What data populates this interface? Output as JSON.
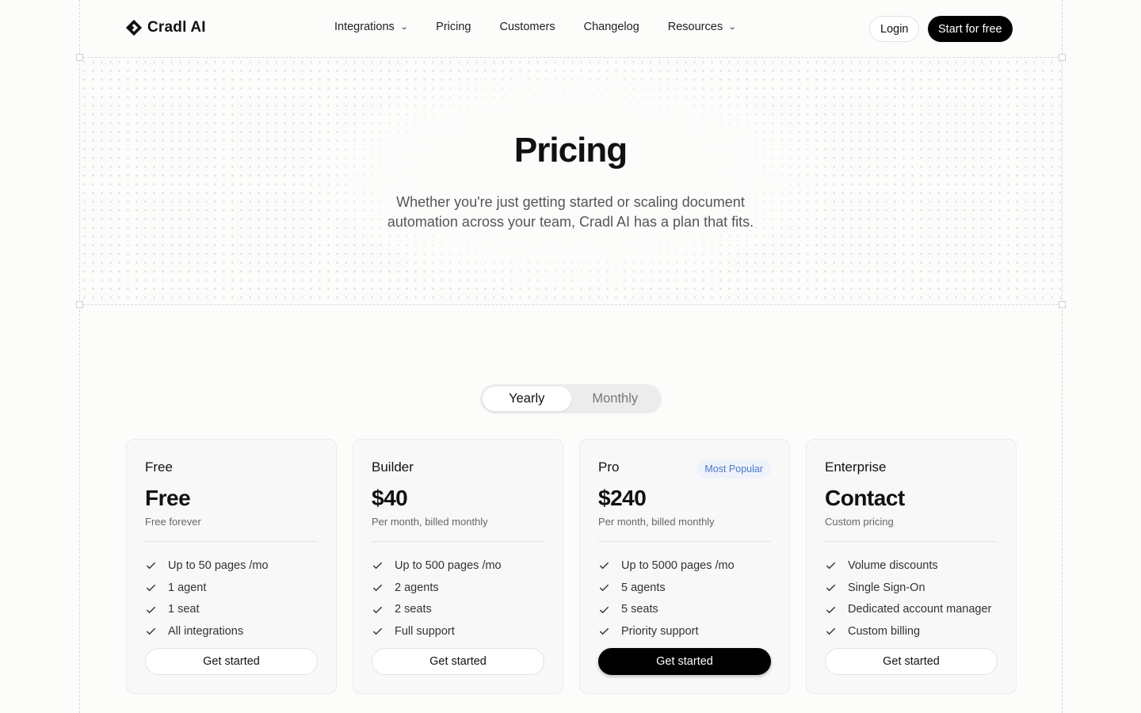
{
  "brand": {
    "name": "Cradl AI"
  },
  "nav": {
    "items": [
      {
        "label": "Integrations",
        "has_dropdown": true
      },
      {
        "label": "Pricing",
        "has_dropdown": false
      },
      {
        "label": "Customers",
        "has_dropdown": false
      },
      {
        "label": "Changelog",
        "has_dropdown": false
      },
      {
        "label": "Resources",
        "has_dropdown": true
      }
    ],
    "login_label": "Login",
    "start_label": "Start for free"
  },
  "hero": {
    "title": "Pricing",
    "subtitle": "Whether you're just getting started or scaling document automation across your team, Cradl AI has a plan that fits."
  },
  "billing_toggle": {
    "options": [
      "Yearly",
      "Monthly"
    ],
    "selected": "Yearly"
  },
  "plans": [
    {
      "name": "Free",
      "badge": "",
      "price": "Free",
      "note": "Free forever",
      "features": [
        "Up to 50 pages /mo",
        "1 agent",
        "1 seat",
        "All integrations"
      ],
      "cta": "Get started",
      "cta_primary": false
    },
    {
      "name": "Builder",
      "badge": "",
      "price": "$40",
      "note": "Per month, billed monthly",
      "features": [
        "Up to 500 pages /mo",
        "2 agents",
        "2 seats",
        "Full support"
      ],
      "cta": "Get started",
      "cta_primary": false
    },
    {
      "name": "Pro",
      "badge": "Most Popular",
      "price": "$240",
      "note": "Per month, billed monthly",
      "features": [
        "Up to 5000 pages /mo",
        "5 agents",
        "5 seats",
        "Priority support"
      ],
      "cta": "Get started",
      "cta_primary": true
    },
    {
      "name": "Enterprise",
      "badge": "",
      "price": "Contact",
      "note": "Custom pricing",
      "features": [
        "Volume discounts",
        "Single Sign-On",
        "Dedicated account manager",
        "Custom billing"
      ],
      "cta": "Get started",
      "cta_primary": false
    }
  ],
  "colors": {
    "accent_badge_text": "#4a78c8",
    "accent_badge_bg": "#eef2fb",
    "primary_button": "#000000"
  },
  "icons": {
    "logo": "cradl-diamond-logo",
    "feature": "check-icon",
    "dropdown": "chevron-down-icon"
  }
}
